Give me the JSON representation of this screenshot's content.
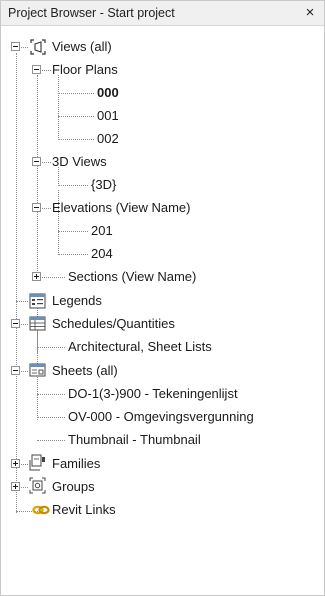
{
  "panel": {
    "title": "Project Browser - Start project",
    "close_glyph": "×"
  },
  "tree": {
    "views": {
      "label": "Views (all)",
      "icon": "views-icon",
      "floor_plans": {
        "label": "Floor Plans",
        "items": [
          "000",
          "001",
          "002"
        ],
        "selected": "000"
      },
      "views_3d": {
        "label": "3D Views",
        "items": [
          "{3D}"
        ]
      },
      "elevations": {
        "label": "Elevations (View Name)",
        "items": [
          "201",
          "204"
        ]
      },
      "sections": {
        "label": "Sections (View Name)",
        "collapsed": true
      }
    },
    "legends": {
      "label": "Legends",
      "icon": "legend-icon"
    },
    "schedules": {
      "label": "Schedules/Quantities",
      "icon": "schedule-icon",
      "items": [
        "Architectural, Sheet Lists"
      ]
    },
    "sheets": {
      "label": "Sheets (all)",
      "icon": "sheets-icon",
      "items": [
        "DO-1(3-)900 - Tekeningenlijst",
        "OV-000 - Omgevingsvergunning",
        "Thumbnail - Thumbnail"
      ]
    },
    "families": {
      "label": "Families",
      "icon": "families-icon",
      "collapsed": true
    },
    "groups": {
      "label": "Groups",
      "icon": "groups-icon",
      "collapsed": true
    },
    "revit_links": {
      "label": "Revit Links",
      "icon": "link-icon"
    }
  },
  "colors": {
    "title_bar": "#f0f0f0",
    "connector": "#8c8c8c",
    "link_icon": "#d9a400"
  }
}
